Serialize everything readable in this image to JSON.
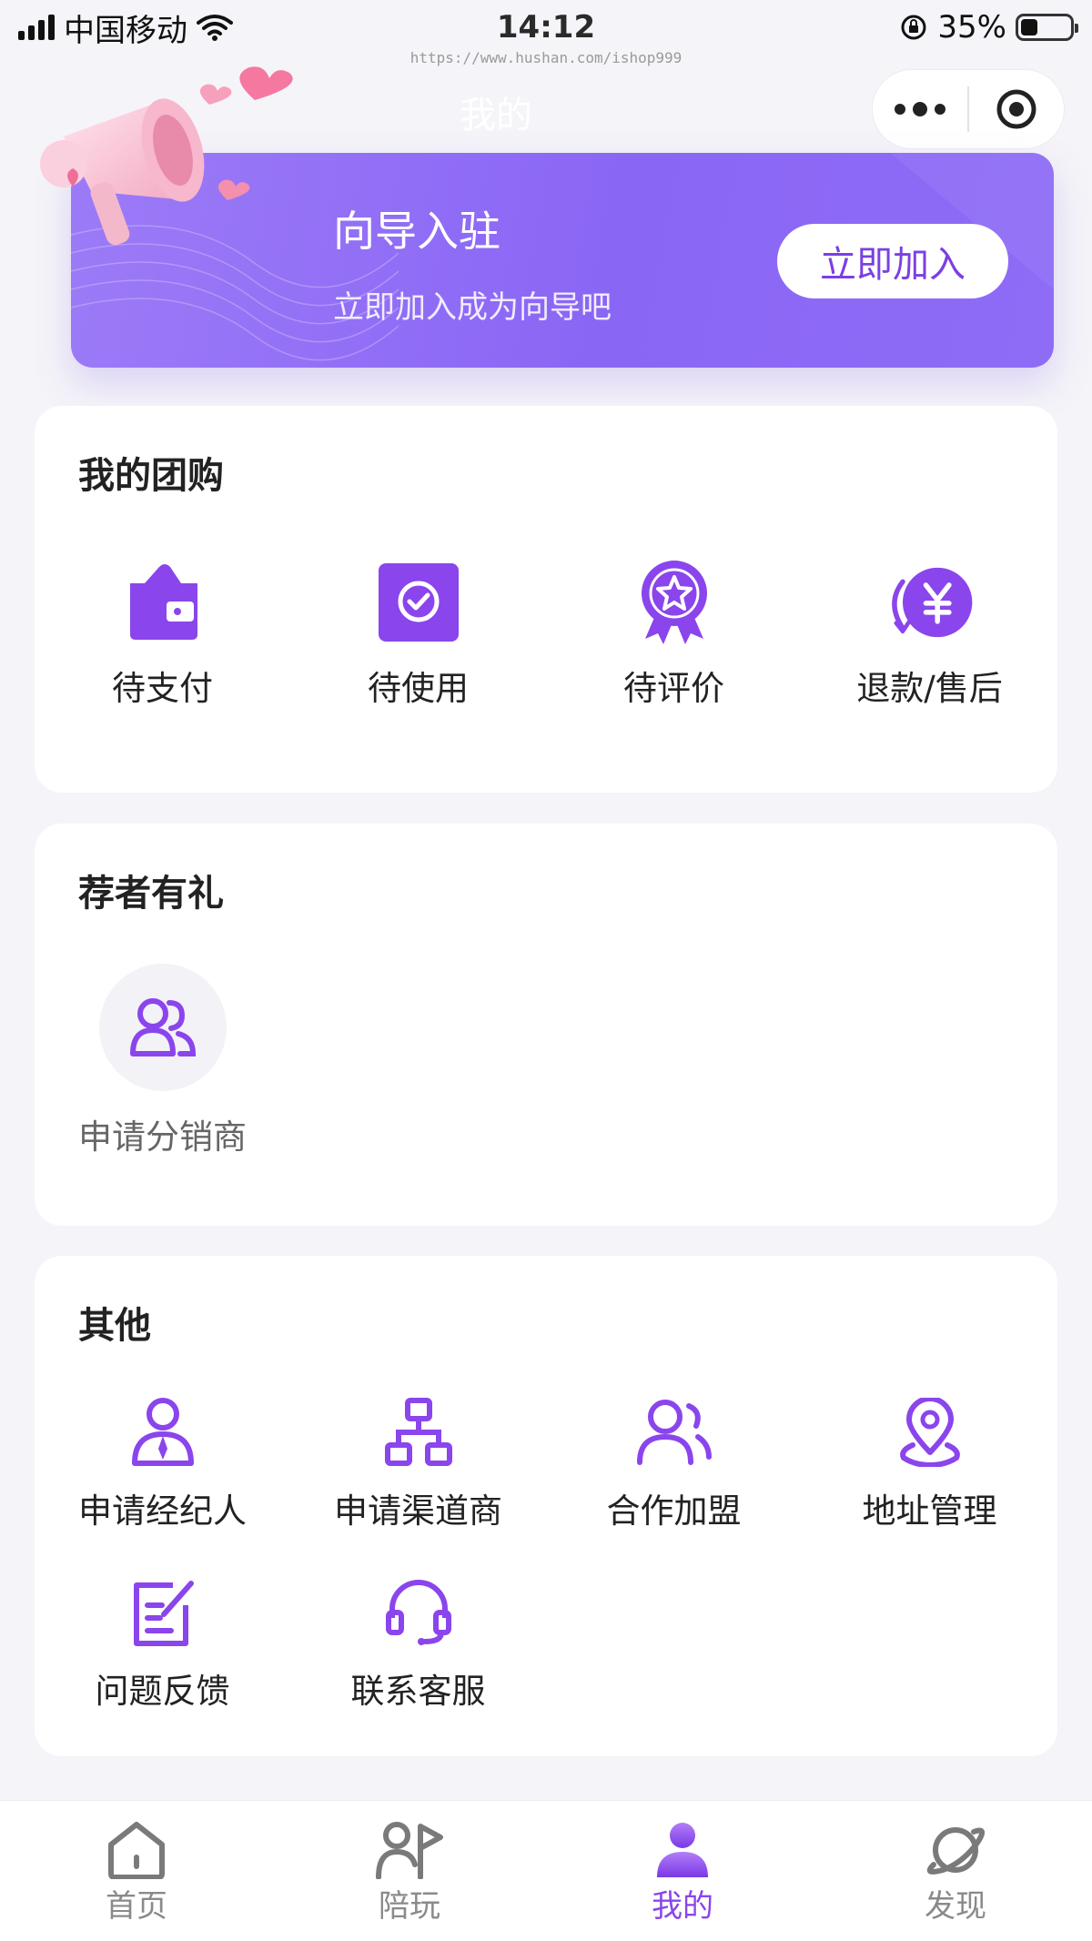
{
  "status_bar": {
    "carrier": "中国移动",
    "time": "14:12",
    "battery": "35%",
    "battery_level": 0.35
  },
  "watermark": "https://www.hushan.com/ishop999",
  "nav": {
    "title": "我的"
  },
  "banner": {
    "title": "向导入驻",
    "subtitle": "立即加入成为向导吧",
    "button": "立即加入"
  },
  "group_buy": {
    "title": "我的团购",
    "items": [
      {
        "label": "待支付",
        "icon": "wallet-icon"
      },
      {
        "label": "待使用",
        "icon": "check-box-icon"
      },
      {
        "label": "待评价",
        "icon": "star-badge-icon"
      },
      {
        "label": "退款/售后",
        "icon": "refund-yen-icon"
      }
    ]
  },
  "referral": {
    "title": "荐者有礼",
    "items": [
      {
        "label": "申请分销商",
        "icon": "users-icon"
      }
    ]
  },
  "other": {
    "title": "其他",
    "items": [
      {
        "label": "申请经纪人",
        "icon": "agent-icon"
      },
      {
        "label": "申请渠道商",
        "icon": "network-icon"
      },
      {
        "label": "合作加盟",
        "icon": "partner-icon"
      },
      {
        "label": "地址管理",
        "icon": "location-pin-icon"
      },
      {
        "label": "问题反馈",
        "icon": "feedback-edit-icon"
      },
      {
        "label": "联系客服",
        "icon": "headset-icon"
      }
    ]
  },
  "tabbar": {
    "items": [
      {
        "label": "首页",
        "icon": "home-icon",
        "active": false
      },
      {
        "label": "陪玩",
        "icon": "companion-flag-icon",
        "active": false
      },
      {
        "label": "我的",
        "icon": "profile-icon",
        "active": true
      },
      {
        "label": "发现",
        "icon": "planet-icon",
        "active": false
      }
    ]
  },
  "colors": {
    "accent": "#8a45ec",
    "banner": "#8a66f5",
    "background": "#f5f4f8"
  }
}
